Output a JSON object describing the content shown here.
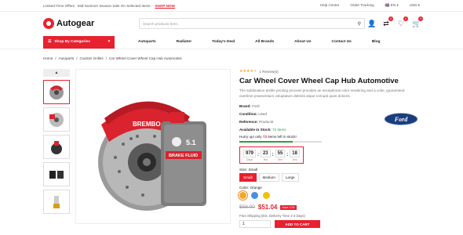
{
  "topbar": {
    "promo": "Limited-Time Offers : Mid-Summer Season Sale On Selected Items -",
    "promo_link": "SHOP NOW",
    "help": "Help Center",
    "tracking": "Order Tracking",
    "language": "EN",
    "currency": "USD"
  },
  "header": {
    "logo": "Autogear",
    "search_placeholder": "Search products here..",
    "badges": {
      "compare": "0",
      "wishlist": "0",
      "cart": "0"
    }
  },
  "nav": {
    "categories": "Shop By Categories",
    "items": [
      "Autoparts",
      "Radiator",
      "Today's Deal",
      "All Brands",
      "About Us",
      "Contact Us",
      "Blog"
    ]
  },
  "breadcrumb": [
    "Home",
    "Autoparts",
    "Custom Grilles",
    "Car Wheel Cover Wheel Cap Hub Automotive"
  ],
  "product": {
    "reviews": "1 Review(s)",
    "rating": 4,
    "title": "Car Wheel Cover Wheel Cap Hub Automotive",
    "description": "The sublimation textile printing process provides an exceptional color rendering and a color, guaranteed overtime praesentium voluptatum deleniti atque corrupti quos dolores.",
    "brand_label": "Brand:",
    "brand": "Ford",
    "condition_label": "Condition:",
    "condition": "Used",
    "reference_label": "Reference:",
    "reference": "Product2",
    "stock_label": "Available In Stock:",
    "stock": "72 Items",
    "hurry_pre": "Hurry up! only",
    "hurry_num": "72",
    "hurry_post": "items left in stock!",
    "stock_fraction": 0.65,
    "countdown": [
      {
        "n": "979",
        "l": "Days"
      },
      {
        "n": "23",
        "l": "Hrs"
      },
      {
        "n": "55",
        "l": "Min"
      },
      {
        "n": "18",
        "l": "Sec"
      }
    ],
    "size_label": "Size: Small",
    "sizes": [
      "Small",
      "Medium",
      "Large"
    ],
    "color_label": "Color: Orange",
    "colors": [
      "#f5a623",
      "#4a90e2",
      "#f2c200"
    ],
    "old_price": "$58.00",
    "new_price": "$51.04",
    "save": "Save 12%",
    "shipping": "Free Shipping (Est. Delivery Time 2-3 Days)",
    "qty": "1",
    "add_to_cart": "ADD TO CART"
  },
  "colors": {
    "accent": "#e8212f",
    "green": "#2e9d4a"
  }
}
